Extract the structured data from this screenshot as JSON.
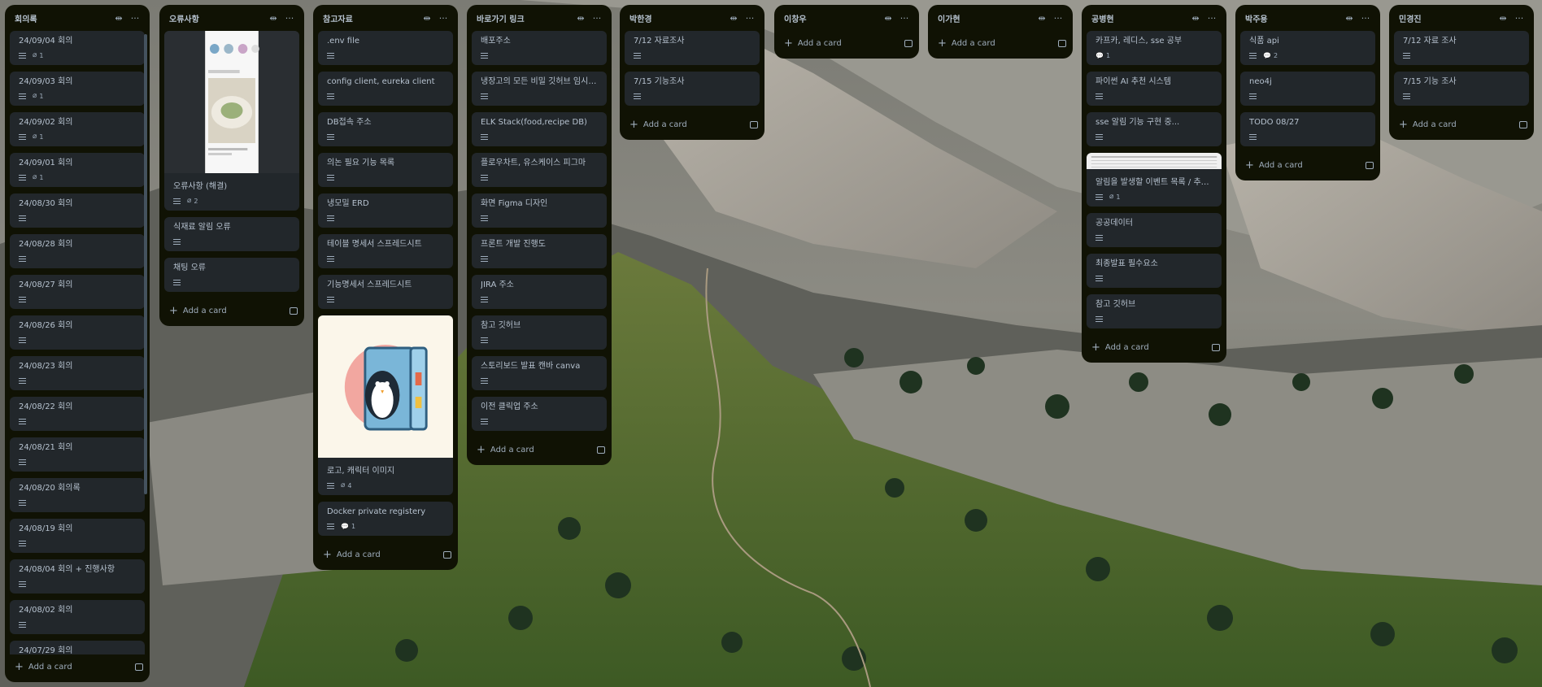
{
  "lists": [
    {
      "title": "회의록",
      "cards": [
        {
          "title": "24/09/04 회의",
          "desc": true,
          "attach": "1"
        },
        {
          "title": "24/09/03 회의",
          "desc": true,
          "attach": "1"
        },
        {
          "title": "24/09/02 회의",
          "desc": true,
          "attach": "1"
        },
        {
          "title": "24/09/01 회의",
          "desc": true,
          "attach": "1"
        },
        {
          "title": "24/08/30 회의",
          "desc": true
        },
        {
          "title": "24/08/28 회의",
          "desc": true
        },
        {
          "title": "24/08/27 회의",
          "desc": true
        },
        {
          "title": "24/08/26 회의",
          "desc": true
        },
        {
          "title": "24/08/23 회의",
          "desc": true
        },
        {
          "title": "24/08/22 회의",
          "desc": true
        },
        {
          "title": "24/08/21 회의",
          "desc": true
        },
        {
          "title": "24/08/20 회의록",
          "desc": true
        },
        {
          "title": "24/08/19 회의",
          "desc": true
        },
        {
          "title": "24/08/04 회의 + 진행사항",
          "desc": true
        },
        {
          "title": "24/08/02 회의",
          "desc": true
        },
        {
          "title": "24/07/29 회의",
          "desc": true
        }
      ]
    },
    {
      "title": "오류사항",
      "cards": [
        {
          "title": "오류사항 (해결)",
          "desc": true,
          "attach": "2",
          "cover": "screenshot"
        },
        {
          "title": "식재료 알림 오류",
          "desc": true
        },
        {
          "title": "채팅 오류",
          "desc": true
        }
      ]
    },
    {
      "title": "참고자료",
      "cards": [
        {
          "title": ".env file",
          "desc": true
        },
        {
          "title": "config client, eureka client",
          "desc": true
        },
        {
          "title": "DB접속 주소",
          "desc": true
        },
        {
          "title": "의논 필요 기능 목록",
          "desc": true
        },
        {
          "title": "냉모밀 ERD",
          "desc": true
        },
        {
          "title": "테이블 명세서 스프레드시트",
          "desc": true
        },
        {
          "title": "기능명세서 스프레드시트",
          "desc": true
        },
        {
          "title": "로고, 캐릭터 이미지",
          "desc": true,
          "attach": "4",
          "cover": "penguin"
        },
        {
          "title": "Docker private registery",
          "desc": true,
          "comments": "1"
        }
      ]
    },
    {
      "title": "바로가기 링크",
      "cards": [
        {
          "title": "배포주소",
          "desc": true
        },
        {
          "title": "냉장고의 모든 비밀 깃허브 임시제목",
          "desc": true
        },
        {
          "title": "ELK Stack(food,recipe DB)",
          "desc": true
        },
        {
          "title": "플로우차트, 유스케이스 피그마",
          "desc": true
        },
        {
          "title": "화면 Figma 디자인",
          "desc": true
        },
        {
          "title": "프론트 개발 진행도",
          "desc": true
        },
        {
          "title": "JIRA 주소",
          "desc": true
        },
        {
          "title": "참고 깃허브",
          "desc": true
        },
        {
          "title": "스토리보드 발표 캔바 canva",
          "desc": true
        },
        {
          "title": "이전 클릭업 주소",
          "desc": true
        }
      ]
    },
    {
      "title": "박한경",
      "cards": [
        {
          "title": "7/12 자료조사",
          "desc": true
        },
        {
          "title": "7/15 기능조사",
          "desc": true
        }
      ]
    },
    {
      "title": "이창우",
      "cards": []
    },
    {
      "title": "이가현",
      "cards": []
    },
    {
      "title": "공병현",
      "cards": [
        {
          "title": "카프카, 레디스, sse 공부",
          "comments": "1"
        },
        {
          "title": "파이썬 AI 추천 시스템",
          "desc": true
        },
        {
          "title": "sse 알림 기능 구현 중...",
          "desc": true
        },
        {
          "title": "알림을 발생할 이벤트 목록 / 추가 중...",
          "desc": true,
          "attach": "1",
          "cover": "table"
        },
        {
          "title": "공공데이터",
          "desc": true
        },
        {
          "title": "최종발표 필수요소",
          "desc": true
        },
        {
          "title": "참고 깃허브",
          "desc": true
        }
      ]
    },
    {
      "title": "박주용",
      "cards": [
        {
          "title": "식품 api",
          "desc": true,
          "comments": "2"
        },
        {
          "title": "neo4j",
          "desc": true
        },
        {
          "title": "TODO 08/27",
          "desc": true
        }
      ]
    },
    {
      "title": "민경진",
      "cards": [
        {
          "title": "7/12 자료 조사",
          "desc": true
        },
        {
          "title": "7/15 기능 조사",
          "desc": true
        }
      ]
    }
  ],
  "ui": {
    "add_card_label": "Add a card"
  }
}
